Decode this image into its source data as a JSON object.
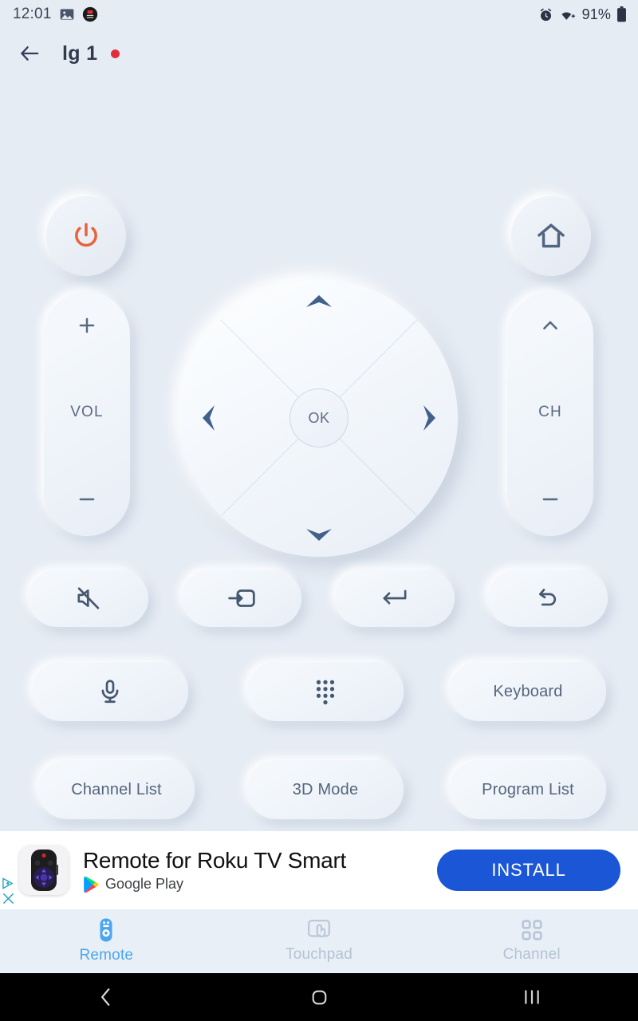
{
  "status_bar": {
    "time": "12:01",
    "battery_percent": "91%",
    "icons": [
      "image-icon",
      "app-notification-icon",
      "alarm-icon",
      "wifi-icon",
      "battery-icon"
    ]
  },
  "header": {
    "back_label": "back-arrow",
    "title": "lg 1",
    "connection_dot_color": "#e02f3c"
  },
  "remote": {
    "power_label": "power",
    "home_label": "home",
    "volume": {
      "label": "VOL",
      "up": "+",
      "down": "−"
    },
    "channel": {
      "label": "CH",
      "up": "chevron-up",
      "down": "−"
    },
    "dpad": {
      "ok_label": "OK",
      "up": "up",
      "down": "down",
      "left": "left",
      "right": "right"
    },
    "function_row": [
      {
        "name": "mute",
        "icon": "mute-icon"
      },
      {
        "name": "input-source",
        "icon": "input-source-icon"
      },
      {
        "name": "enter",
        "icon": "enter-icon"
      },
      {
        "name": "back",
        "icon": "back-undo-icon"
      }
    ],
    "second_row": [
      {
        "name": "voice",
        "icon": "microphone-icon",
        "label": ""
      },
      {
        "name": "keypad",
        "icon": "dialpad-icon",
        "label": ""
      },
      {
        "name": "keyboard",
        "icon": "",
        "label": "Keyboard"
      }
    ],
    "third_row": [
      {
        "name": "channel-list",
        "label": "Channel List"
      },
      {
        "name": "3d-mode",
        "label": "3D Mode"
      },
      {
        "name": "program-list",
        "label": "Program List"
      }
    ]
  },
  "ad": {
    "title": "Remote for Roku TV Smart",
    "source": "Google Play",
    "cta": "INSTALL",
    "cta_color": "#1a56d6",
    "adchoices_icon": "adchoices-icon",
    "close_icon": "close-icon"
  },
  "bottom_nav": {
    "active_color": "#4ba6f0",
    "inactive_color": "#b3c3d4",
    "items": [
      {
        "label": "Remote",
        "icon": "remote-icon",
        "active": true
      },
      {
        "label": "Touchpad",
        "icon": "touchpad-icon",
        "active": false
      },
      {
        "label": "Channel",
        "icon": "grid-icon",
        "active": false
      }
    ]
  },
  "android_nav": {
    "items": [
      {
        "label": "back",
        "icon": "chevron-left-icon"
      },
      {
        "label": "home",
        "icon": "home-square-icon"
      },
      {
        "label": "recents",
        "icon": "recents-icon"
      }
    ]
  }
}
